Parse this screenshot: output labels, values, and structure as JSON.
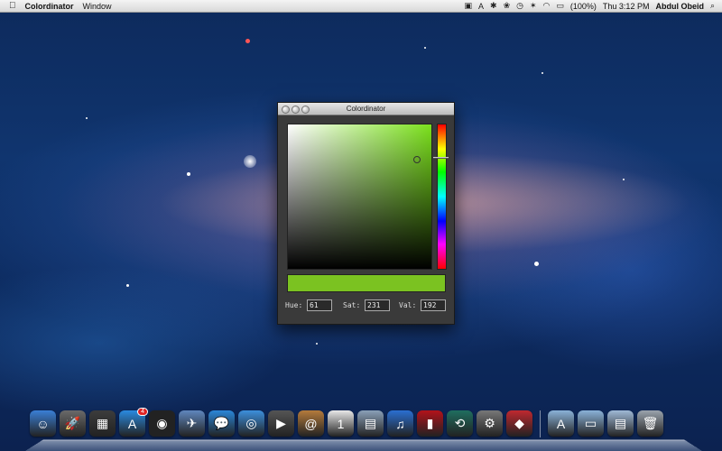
{
  "menubar": {
    "apple_icon": "apple-logo-icon",
    "app_name": "Colordinator",
    "menus": [
      "Window"
    ],
    "battery_text": "(100%)",
    "clock": "Thu 3:12 PM",
    "user": "Abdul Obeid"
  },
  "window": {
    "title": "Colordinator",
    "color": {
      "swatch_hex": "#7bc221",
      "pure_hue_hex": "#7be11c"
    },
    "fields": {
      "hue_label": "Hue:",
      "hue_value": "61",
      "sat_label": "Sat:",
      "sat_value": "231",
      "val_label": "Val:",
      "val_value": "192"
    }
  },
  "dock": {
    "apps": [
      {
        "name": "finder-icon",
        "glyph": "☺",
        "color": "#3a7fd6"
      },
      {
        "name": "launchpad-icon",
        "glyph": "🚀",
        "color": "#6a6a6a"
      },
      {
        "name": "mission-control-icon",
        "glyph": "▦",
        "color": "#3c3c3c"
      },
      {
        "name": "app-store-icon",
        "glyph": "A",
        "color": "#2a8ae0",
        "badge": "4"
      },
      {
        "name": "dashboard-icon",
        "glyph": "◉",
        "color": "#222"
      },
      {
        "name": "mail-icon",
        "glyph": "✈",
        "color": "#5f86bd"
      },
      {
        "name": "ichat-icon",
        "glyph": "💬",
        "color": "#2a86d8"
      },
      {
        "name": "safari-icon",
        "glyph": "◎",
        "color": "#3c8fdc"
      },
      {
        "name": "facetime-icon",
        "glyph": "▶",
        "color": "#555"
      },
      {
        "name": "address-book-icon",
        "glyph": "@",
        "color": "#b57b3c"
      },
      {
        "name": "ical-icon",
        "glyph": "1",
        "color": "#e8e8e8"
      },
      {
        "name": "preview-icon",
        "glyph": "▤",
        "color": "#8aa0b8"
      },
      {
        "name": "itunes-icon",
        "glyph": "♫",
        "color": "#2a6fd1"
      },
      {
        "name": "photo-booth-icon",
        "glyph": "▮",
        "color": "#b3121a"
      },
      {
        "name": "time-machine-icon",
        "glyph": "⟲",
        "color": "#1f6e5f"
      },
      {
        "name": "system-preferences-icon",
        "glyph": "⚙",
        "color": "#777"
      },
      {
        "name": "colordinator-dock-icon",
        "glyph": "◆",
        "color": "#c0282f"
      }
    ],
    "stacks": [
      {
        "name": "applications-folder-icon",
        "glyph": "A",
        "color": "#8ab2d8"
      },
      {
        "name": "documents-folder-icon",
        "glyph": "▭",
        "color": "#8ab2d8"
      },
      {
        "name": "downloads-folder-icon",
        "glyph": "▤",
        "color": "#9fb9d6"
      },
      {
        "name": "trash-icon",
        "glyph": "🗑",
        "color": "#9aa3ad"
      }
    ]
  }
}
